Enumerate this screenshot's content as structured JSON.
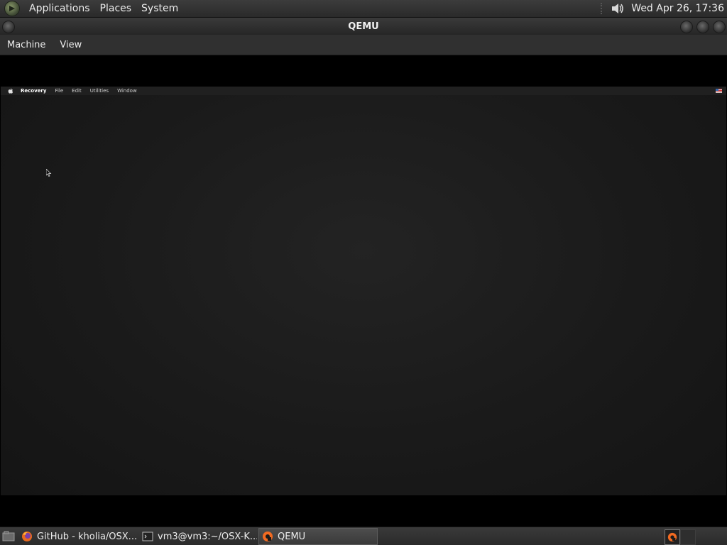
{
  "top_panel": {
    "menus": [
      "Applications",
      "Places",
      "System"
    ],
    "clock": "Wed Apr 26, 17:36",
    "icons": {
      "launcher": "gnome-foot-icon",
      "volume": "speaker-icon"
    }
  },
  "window": {
    "title": "QEMU"
  },
  "qemu_menu": [
    "Machine",
    "View"
  ],
  "guest": {
    "menubar": {
      "app_name": "Recovery",
      "items": [
        "File",
        "Edit",
        "Utilities",
        "Window"
      ],
      "icons": {
        "apple": "apple-icon",
        "input_source": "us-flag-icon"
      }
    },
    "background_color": "#1c1c1c"
  },
  "taskbar": {
    "tasks": [
      {
        "label": "GitHub - kholia/OSX...",
        "icon": "firefox-icon",
        "active": false
      },
      {
        "label": "vm3@vm3:~/OSX-K...",
        "icon": "terminal-icon",
        "active": false
      },
      {
        "label": "QEMU",
        "icon": "qemu-icon",
        "active": true
      }
    ]
  },
  "colors": {
    "panel": "#2f2f2f",
    "titlebar": "#2c2c2c",
    "vm_border": "#000000"
  }
}
